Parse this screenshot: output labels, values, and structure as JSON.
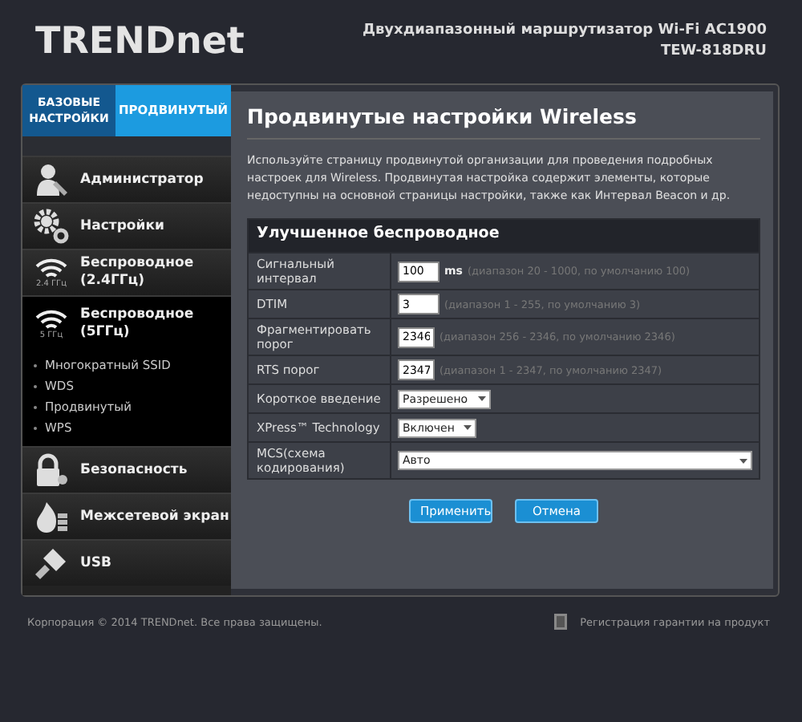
{
  "header": {
    "logo": "TRENDnet",
    "product_line": "Двухдиапазонный маршрутизатор Wi-Fi AC1900",
    "model": "TEW-818DRU"
  },
  "mode_tabs": [
    {
      "label": "БАЗОВЫЕ НАСТРОЙКИ",
      "selected": false
    },
    {
      "label": "ПРОДВИНУТЫЙ",
      "selected": true
    }
  ],
  "sidebar": {
    "items": [
      {
        "label": "Администратор",
        "kind": "admin",
        "selected": false
      },
      {
        "label": "Настройки",
        "kind": "gears",
        "selected": false
      },
      {
        "label": "Беспроводное (2.4ГГц)",
        "kind": "wifi",
        "icon_caption": "2.4 ГГц",
        "selected": false
      },
      {
        "label": "Беспроводное (5ГГц)",
        "kind": "wifi",
        "icon_caption": "5 ГГц",
        "selected": true,
        "expanded": true,
        "children": [
          {
            "label": "Многократный SSID"
          },
          {
            "label": "WDS"
          },
          {
            "label": "Продвинутый"
          },
          {
            "label": "WPS"
          }
        ]
      },
      {
        "label": "Безопасность",
        "kind": "lock",
        "selected": false
      },
      {
        "label": "Межсетевой экран",
        "kind": "fire",
        "selected": false
      },
      {
        "label": "USB",
        "kind": "usb",
        "selected": false
      }
    ]
  },
  "content": {
    "title": "Продвинутые настройки Wireless",
    "description": "Используйте страницу продвинутой организации для проведения подробных настроек для Wireless. Продвинутая настройка содержит элементы, которые недоступны на основной страницы настройки, также как Интервал Beacon и др.",
    "section_title": "Улучшенное беспроводное",
    "rows": [
      {
        "kind": "input",
        "label": "Сигнальный интервал",
        "value": "100",
        "unit": "ms",
        "hint": "(диапазон 20 - 1000, по умолчанию 100)"
      },
      {
        "kind": "input",
        "label": "DTIM",
        "value": "3",
        "hint": "(диапазон 1 - 255, по умолчанию 3)"
      },
      {
        "kind": "input",
        "label": "Фрагментировать порог",
        "value": "2346",
        "hint": "(диапазон 256 - 2346, по умолчанию 2346)"
      },
      {
        "kind": "input",
        "label": "RTS порог",
        "value": "2347",
        "hint": "(диапазон 1 - 2347, по умолчанию 2347)"
      },
      {
        "kind": "select",
        "label": "Короткое введение",
        "value": "Разрешено"
      },
      {
        "kind": "select",
        "label": "XPress™ Technology",
        "value": "Включен"
      },
      {
        "kind": "select_wide",
        "label": "MCS(схема кодирования)",
        "value": "Авто"
      }
    ],
    "buttons": [
      "Применить",
      "Отмена"
    ]
  },
  "footer": {
    "copyright": "Корпорация © 2014 TRENDnet. Все права защищены.",
    "warranty_link": "Регистрация гарантии на продукт"
  }
}
